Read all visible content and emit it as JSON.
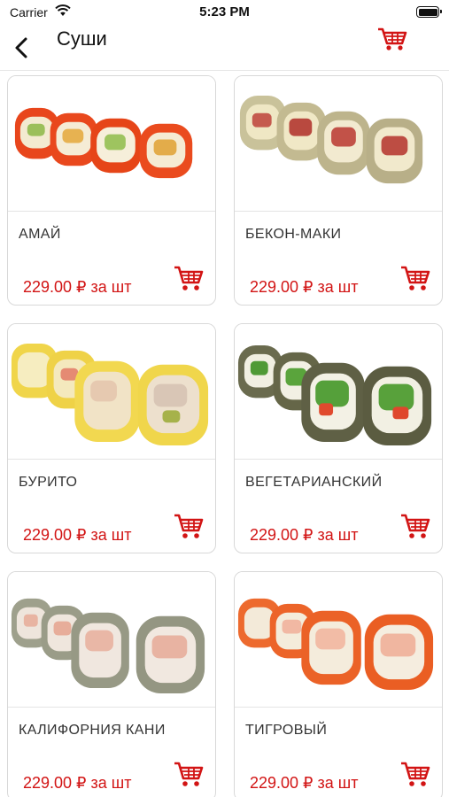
{
  "status_bar": {
    "carrier": "Carrier",
    "time": "5:23 PM"
  },
  "nav": {
    "title": "Суши"
  },
  "colors": {
    "accent": "#d21414"
  },
  "products": [
    {
      "name": "АМАЙ",
      "price": "229.00 ₽ за шт"
    },
    {
      "name": "БЕКОН-МАКИ",
      "price": "229.00 ₽ за шт"
    },
    {
      "name": "БУРИТО",
      "price": "229.00 ₽ за шт"
    },
    {
      "name": "ВЕГЕТАРИАНСКИЙ",
      "price": "229.00 ₽ за шт"
    },
    {
      "name": "КАЛИФОРНИЯ КАНИ",
      "price": "229.00 ₽ за шт"
    },
    {
      "name": "ТИГРОВЫЙ",
      "price": "229.00 ₽ за шт"
    }
  ]
}
